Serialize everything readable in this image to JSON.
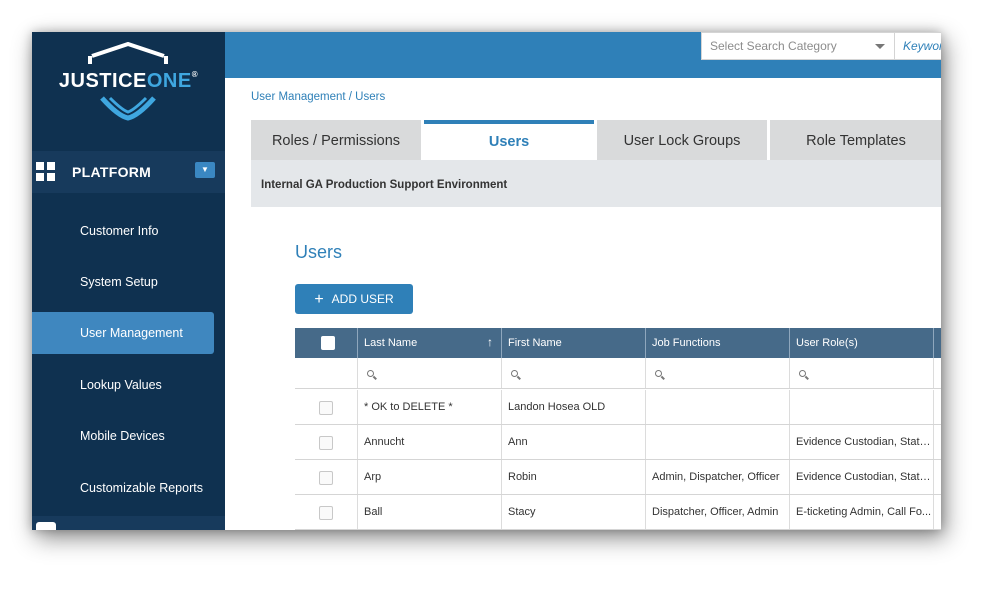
{
  "logo": {
    "brand_main": "JUSTICE",
    "brand_accent": "ONE",
    "trademark": "®"
  },
  "sidebar": {
    "section": "PLATFORM",
    "items": [
      {
        "label": "Customer Info",
        "active": false
      },
      {
        "label": "System Setup",
        "active": false
      },
      {
        "label": "User Management",
        "active": true
      },
      {
        "label": "Lookup Values",
        "active": false
      },
      {
        "label": "Mobile Devices",
        "active": false
      },
      {
        "label": "Customizable Reports",
        "active": false
      }
    ]
  },
  "topbar": {
    "search_category_placeholder": "Select Search Category",
    "keyword_placeholder": "Keyword"
  },
  "breadcrumb": "User Management / Users",
  "tabs": [
    {
      "label": "Roles / Permissions",
      "active": false
    },
    {
      "label": "Users",
      "active": true
    },
    {
      "label": "User Lock Groups",
      "active": false
    },
    {
      "label": "Role Templates",
      "active": false
    }
  ],
  "environment": "Internal GA Production Support Environment",
  "section_title": "Users",
  "add_button": "ADD USER",
  "table": {
    "columns": [
      "Last Name",
      "First Name",
      "Job Functions",
      "User Role(s)"
    ],
    "sort_indicator": "↑",
    "rows": [
      [
        "* OK to DELETE *",
        "Landon Hosea OLD",
        "",
        ""
      ],
      [
        "Annucht",
        "Ann",
        "",
        "Evidence Custodian, State ..."
      ],
      [
        "Arp",
        "Robin",
        "Admin, Dispatcher, Officer",
        "Evidence Custodian, State ..."
      ],
      [
        "Ball",
        "Stacy",
        "Dispatcher, Officer, Admin",
        "E-ticketing Admin, Call Fo..."
      ]
    ]
  },
  "colors": {
    "sidebar_bg": "#0f3150",
    "accent": "#2f80b8",
    "active_nav": "#3f87bf",
    "table_header": "#466a89"
  }
}
